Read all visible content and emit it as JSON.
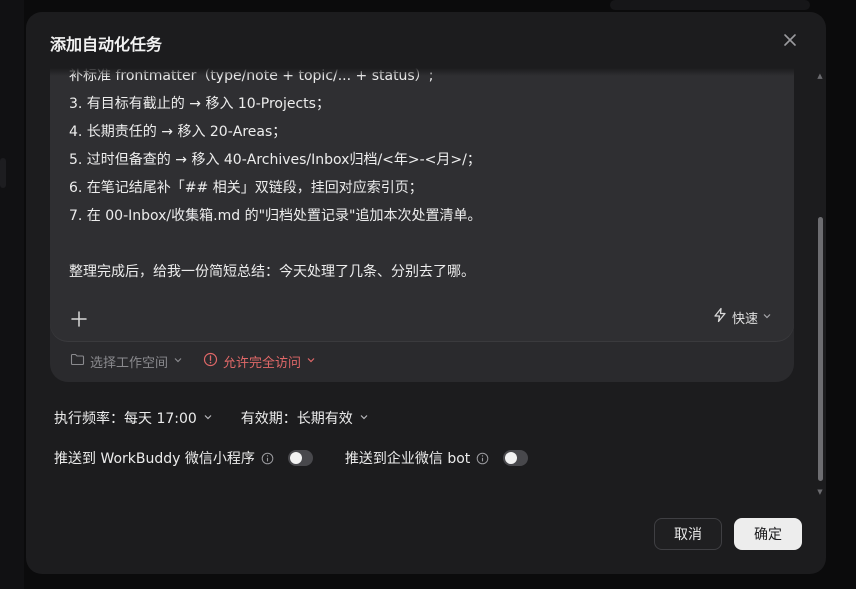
{
  "dialog": {
    "title": "添加自动化任务",
    "prompt_lines": [
      "补标准 frontmatter（type/note + topic/... + status）;",
      "3. 有目标有截止的 → 移入 10-Projects；",
      "4. 长期责任的 → 移入 20-Areas；",
      "5. 过时但备查的 → 移入 40-Archives/Inbox归档/<年>-<月>/；",
      "6. 在笔记结尾补「## 相关」双链段，挂回对应索引页；",
      "7. 在 00-Inbox/收集箱.md 的\"归档处置记录\"追加本次处置清单。",
      "",
      "整理完成后，给我一份简短总结：今天处理了几条、分别去了哪。"
    ],
    "speed_label": "快速",
    "workspace_label": "选择工作空间",
    "access_label": "允许完全访问",
    "frequency_label": "执行频率：每天 17:00",
    "validity_label": "有效期：长期有效",
    "push_workbuddy_label": "推送到 WorkBuddy 微信小程序",
    "push_wecom_label": "推送到企业微信 bot",
    "push_workbuddy_enabled": false,
    "push_wecom_enabled": false,
    "cancel_label": "取消",
    "confirm_label": "确定"
  },
  "colors": {
    "modal_bg": "#1c1c1e",
    "editor_bg": "#2f2f32",
    "access_warning": "#e06868",
    "confirm_bg": "#ededed"
  },
  "icons": [
    "close-icon",
    "plus-icon",
    "lightning-icon",
    "folder-icon",
    "warning-circle-icon",
    "chevron-down-icon",
    "info-icon"
  ]
}
